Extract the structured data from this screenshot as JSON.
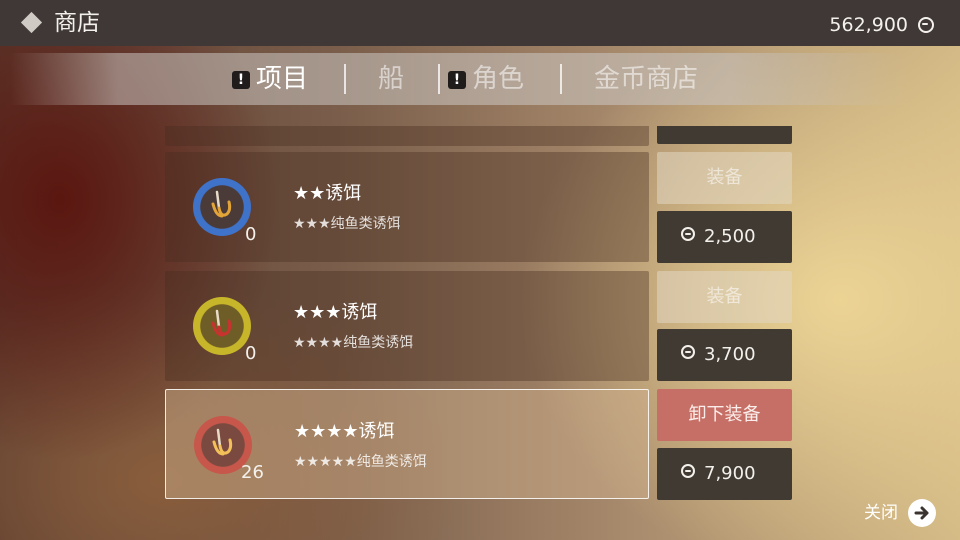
{
  "header": {
    "title": "商店",
    "coin_total": "562,900"
  },
  "tabs": [
    {
      "label": "项目",
      "alert": "!",
      "active": true
    },
    {
      "label": "船",
      "active": false
    },
    {
      "label": "角色",
      "alert": "!",
      "active": false
    },
    {
      "label": "金币商店",
      "active": false
    }
  ],
  "items": [
    {
      "name": "",
      "desc": "",
      "count": "",
      "equip_label": "",
      "price": ""
    },
    {
      "name": "★★诱饵",
      "desc": "★★★纯鱼类诱饵",
      "count": "0",
      "equip_label": "装备",
      "price": "2,500",
      "ring_color": "#3f72c9"
    },
    {
      "name": "★★★诱饵",
      "desc": "★★★★纯鱼类诱饵",
      "count": "0",
      "equip_label": "装备",
      "price": "3,700",
      "ring_color": "#c7b52a"
    },
    {
      "name": "★★★★诱饵",
      "desc": "★★★★★纯鱼类诱饵",
      "count": "26",
      "equip_label": "卸下装备",
      "price": "7,900",
      "ring_color": "#c7564b",
      "selected": true
    }
  ],
  "close_label": "关闭",
  "icons": {
    "header": "diamond-icon",
    "currency": "coin-icon",
    "lure": "lure-hook-icon",
    "close": "arrow-right-icon"
  }
}
